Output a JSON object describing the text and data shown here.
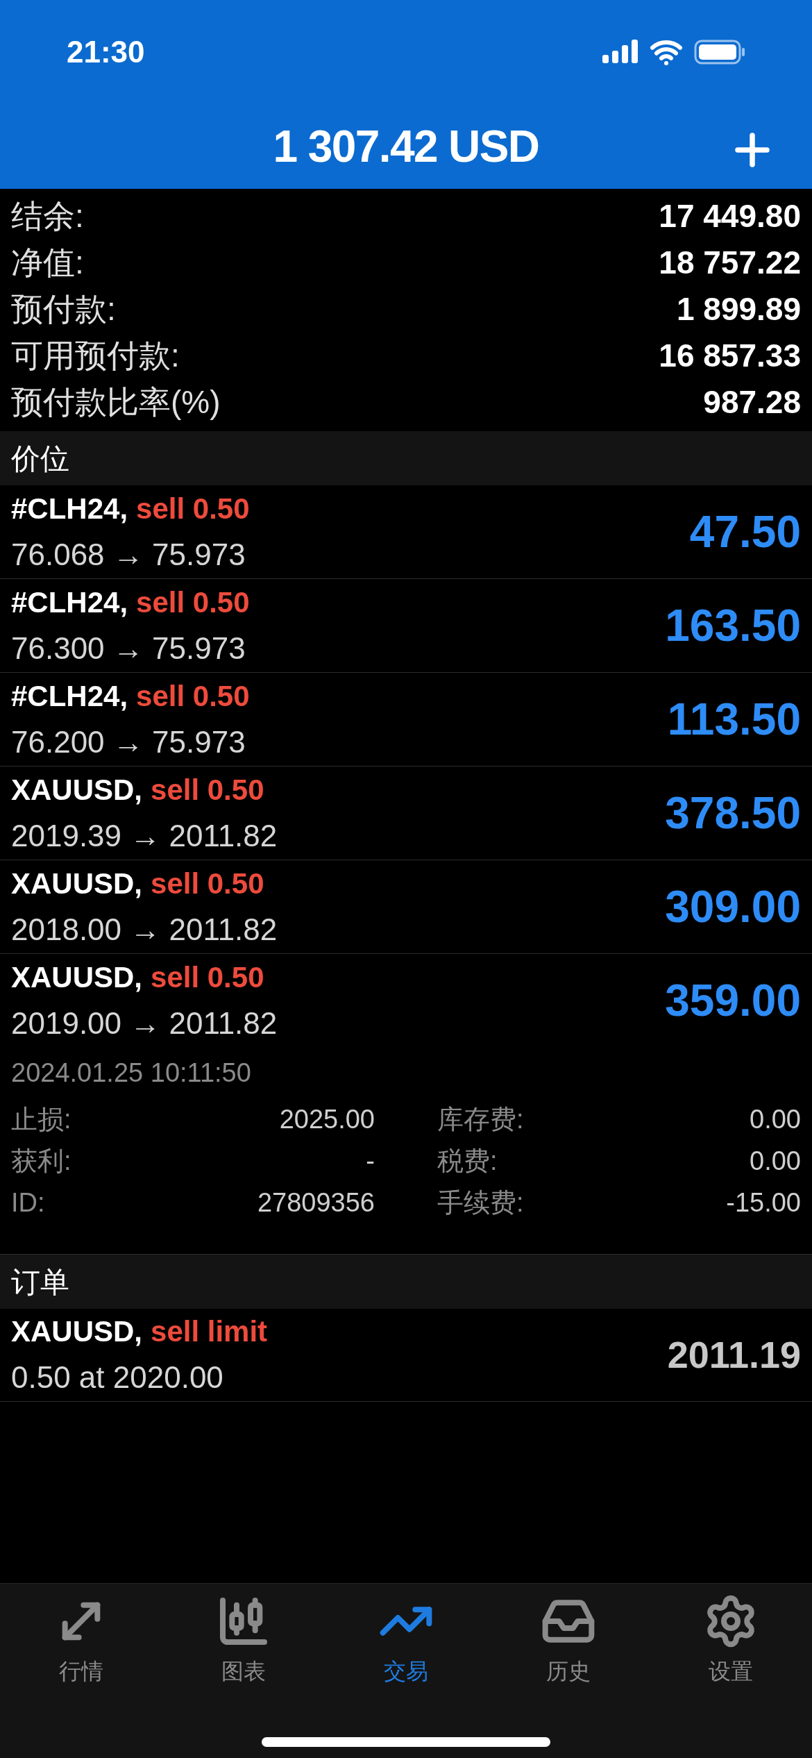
{
  "status_bar": {
    "time": "21:30"
  },
  "header": {
    "title": "1 307.42 USD"
  },
  "summary": [
    {
      "label": "结余:",
      "value": "17 449.80"
    },
    {
      "label": "净值:",
      "value": "18 757.22"
    },
    {
      "label": "预付款:",
      "value": "1 899.89"
    },
    {
      "label": "可用预付款:",
      "value": "16 857.33"
    },
    {
      "label": "预付款比率(%)",
      "value": "987.28"
    }
  ],
  "positions": {
    "title": "价位",
    "items": [
      {
        "symbol": "#CLH24,",
        "side": "sell 0.50",
        "prices": "76.068 → 75.973",
        "profit": "47.50"
      },
      {
        "symbol": "#CLH24,",
        "side": "sell 0.50",
        "prices": "76.300 → 75.973",
        "profit": "163.50"
      },
      {
        "symbol": "#CLH24,",
        "side": "sell 0.50",
        "prices": "76.200 → 75.973",
        "profit": "113.50"
      },
      {
        "symbol": "XAUUSD,",
        "side": "sell 0.50",
        "prices": "2019.39 → 2011.82",
        "profit": "378.50"
      },
      {
        "symbol": "XAUUSD,",
        "side": "sell 0.50",
        "prices": "2018.00 → 2011.82",
        "profit": "309.00"
      },
      {
        "symbol": "XAUUSD,",
        "side": "sell 0.50",
        "prices": "2019.00 → 2011.82",
        "profit": "359.00",
        "details": {
          "time": "2024.01.25 10:11:50",
          "fields": [
            {
              "label": "止损:",
              "value": "2025.00"
            },
            {
              "label": "库存费:",
              "value": "0.00"
            },
            {
              "label": "获利:",
              "value": "-"
            },
            {
              "label": "税费:",
              "value": "0.00"
            },
            {
              "label": "ID:",
              "value": "27809356"
            },
            {
              "label": "手续费:",
              "value": "-15.00"
            }
          ]
        }
      }
    ]
  },
  "orders": {
    "title": "订单",
    "items": [
      {
        "symbol": "XAUUSD,",
        "type": "sell limit",
        "line": "0.50 at 2020.00",
        "price": "2011.19"
      }
    ]
  },
  "tabs": [
    {
      "kind": "quotes",
      "label": "行情",
      "selected": false
    },
    {
      "kind": "chart",
      "label": "图表",
      "selected": false
    },
    {
      "kind": "trade",
      "label": "交易",
      "selected": true
    },
    {
      "kind": "history",
      "label": "历史",
      "selected": false
    },
    {
      "kind": "settings",
      "label": "设置",
      "selected": false
    }
  ]
}
